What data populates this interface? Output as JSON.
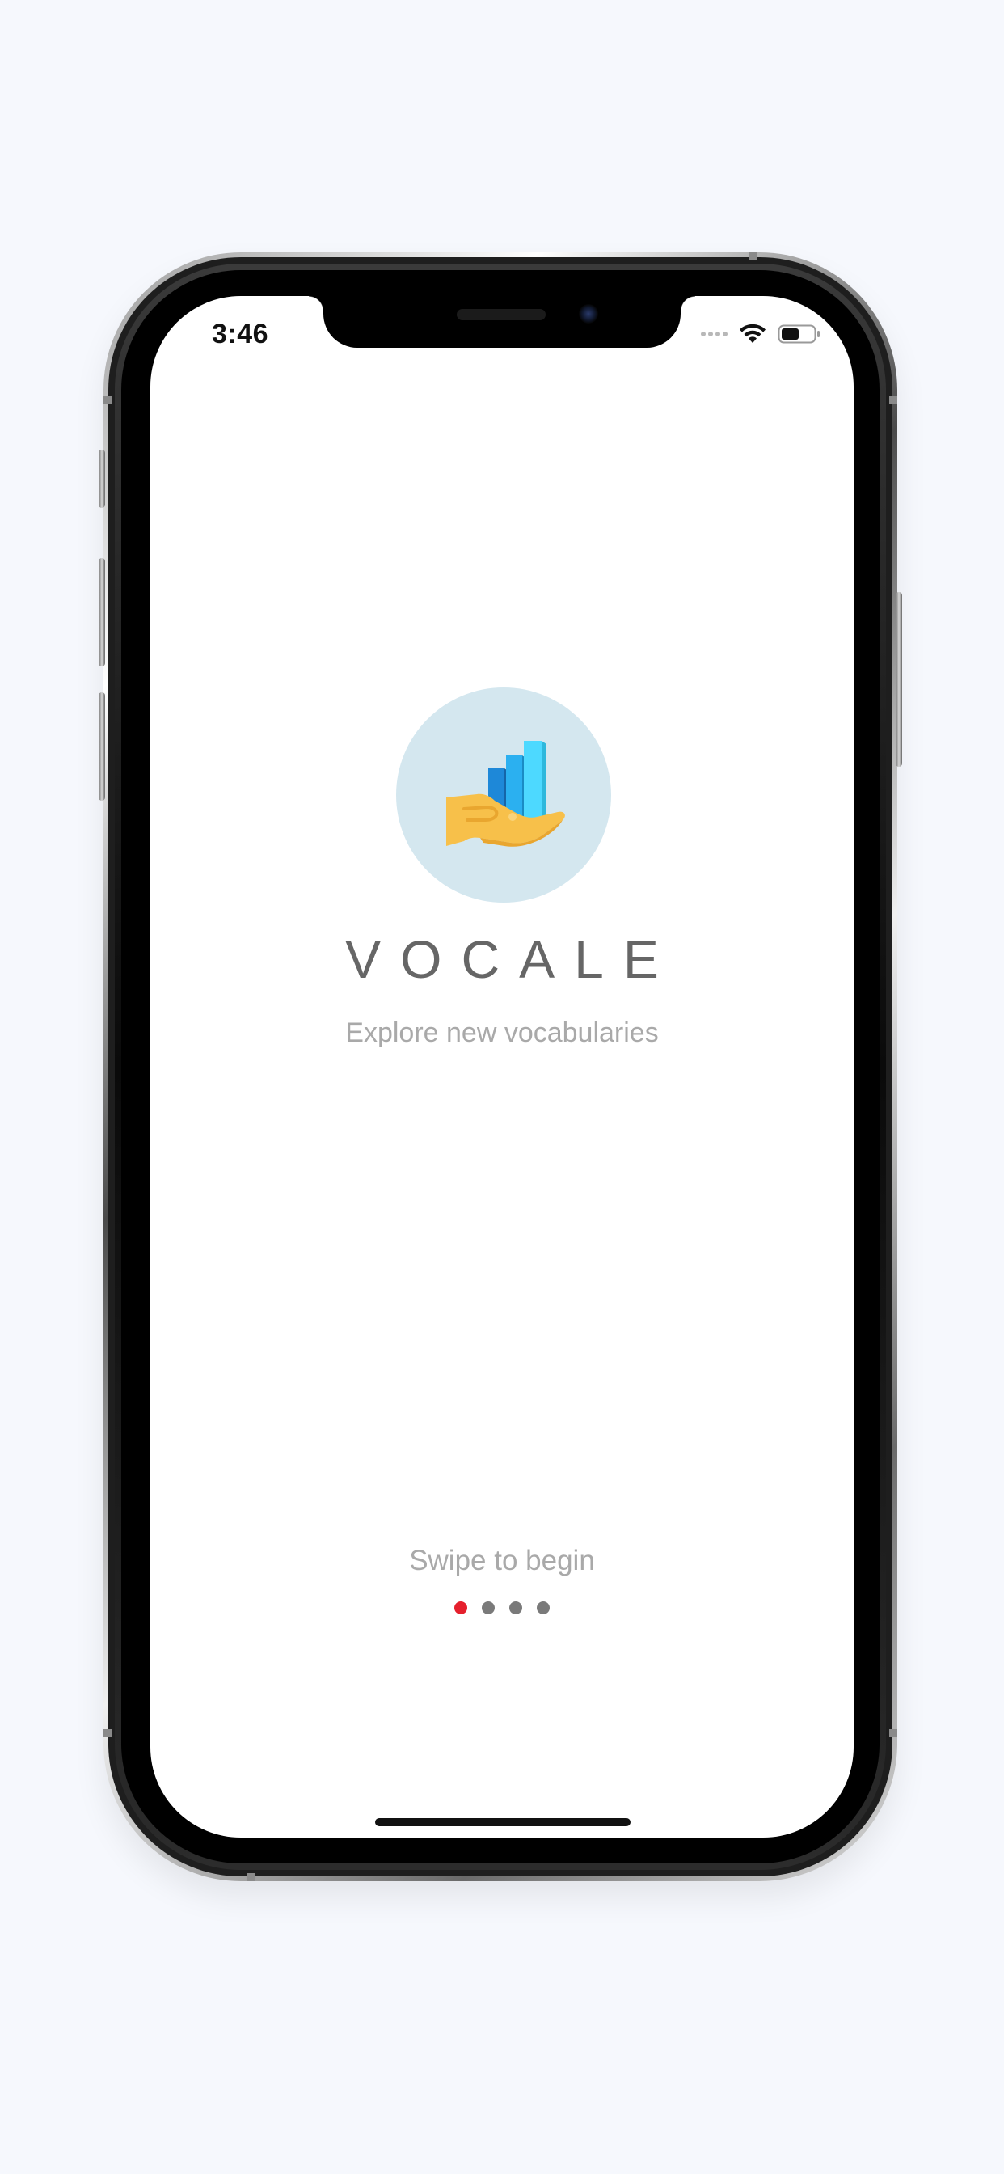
{
  "status_bar": {
    "time": "3:46",
    "icons": [
      "signal-dots-icon",
      "wifi-icon",
      "battery-icon"
    ]
  },
  "logo": {
    "icon": "hand-holding-chart-icon",
    "colors": {
      "circle": "#d4e7ef",
      "hand": "#f7c04a",
      "bar_dark": "#1e88d8",
      "bar_mid": "#2bb0f0",
      "bar_light": "#4dd9ff"
    }
  },
  "app": {
    "name": "VOCALE",
    "tagline": "Explore new vocabularies"
  },
  "onboarding": {
    "swipe_text": "Swipe to begin",
    "page_count": 4,
    "current_page": 1,
    "active_dot_color": "#e5202d",
    "inactive_dot_color": "#7a7a7a"
  }
}
